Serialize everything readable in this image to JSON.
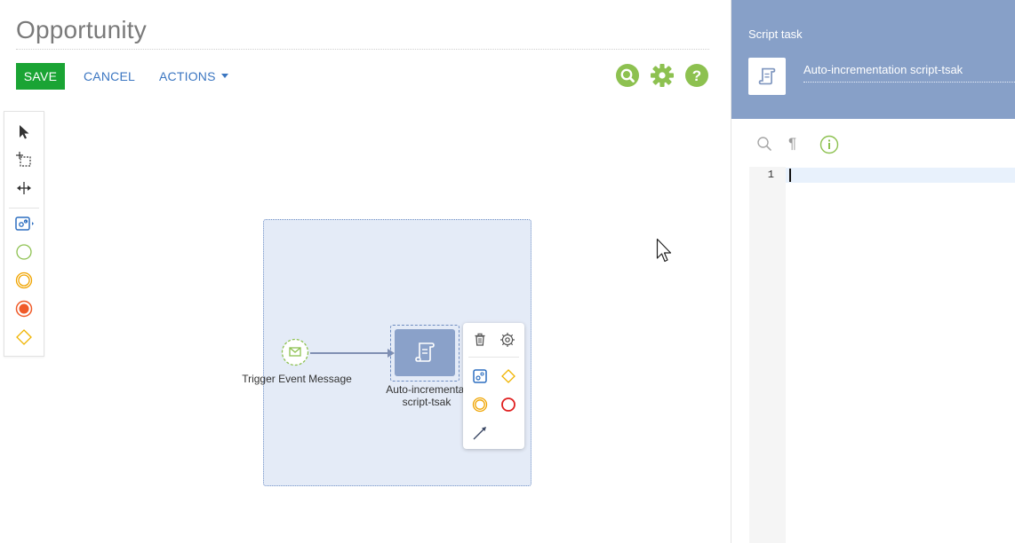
{
  "header": {
    "title": "Opportunity",
    "save_label": "SAVE",
    "cancel_label": "CANCEL",
    "actions_label": "ACTIONS"
  },
  "canvas": {
    "start_event_label": "Trigger Event Message",
    "task_label_line1": "Auto-incrementat",
    "task_label_line2": "script-tsak"
  },
  "panel": {
    "title": "Script task",
    "element_name": "Auto-incrementation script-tsak",
    "paragraph_symbol": "¶",
    "line_number": "1"
  },
  "colors": {
    "save_green": "#1aa434",
    "link_blue": "#3b76c1",
    "icon_green": "#8dc150",
    "panel_header": "#87a0c8",
    "lane_fill": "#e4ebf7"
  }
}
